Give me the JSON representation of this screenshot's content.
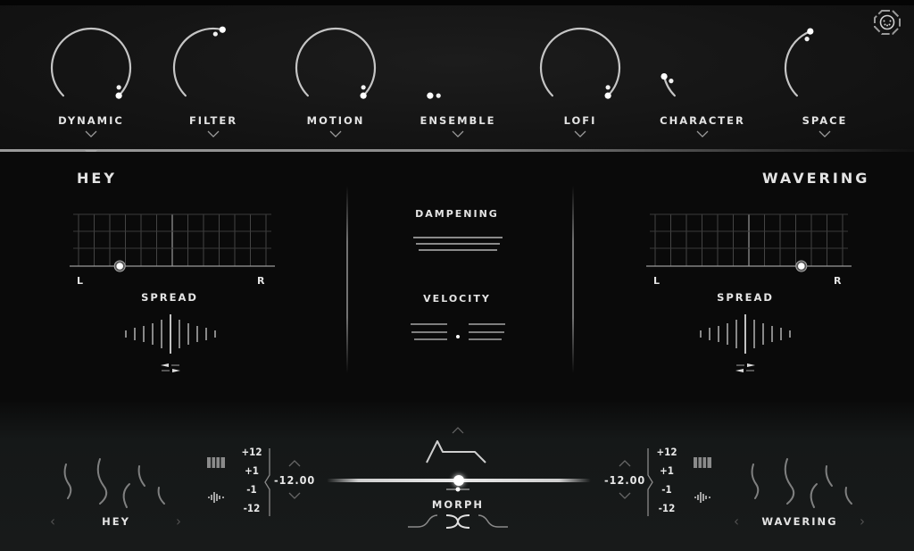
{
  "knobs": [
    {
      "id": "dynamic",
      "label": "DYNAMIC",
      "value": 1.0
    },
    {
      "id": "filter",
      "label": "FILTER",
      "value": 0.55
    },
    {
      "id": "motion",
      "label": "MOTION",
      "value": 1.0
    },
    {
      "id": "ensemble",
      "label": "ENSEMBLE",
      "value": 0.0
    },
    {
      "id": "lofi",
      "label": "LOFI",
      "value": 1.0
    },
    {
      "id": "character",
      "label": "CHARACTER",
      "value": 0.12
    },
    {
      "id": "space",
      "label": "SPACE",
      "value": 0.42
    }
  ],
  "icons": {
    "midi": "midi-connector-icon",
    "chevron": "chevron-down-icon"
  },
  "left": {
    "title": "HEY",
    "pan_label_left": "L",
    "pan_label_right": "R",
    "pan_value": 0.22,
    "spread_label": "SPREAD",
    "preset_name": "HEY",
    "pitch_options": [
      "+12",
      "+1",
      "-1",
      "-12"
    ],
    "pitch_value": "-12.00"
  },
  "right": {
    "title": "WAVERING",
    "pan_label_left": "L",
    "pan_label_right": "R",
    "pan_value": 0.78,
    "spread_label": "SPREAD",
    "preset_name": "WAVERING",
    "pitch_options": [
      "+12",
      "+1",
      "-1",
      "-12"
    ],
    "pitch_value": "-12.00"
  },
  "center": {
    "dampening_label": "DAMPENING",
    "velocity_label": "VELOCITY"
  },
  "morph": {
    "label": "MORPH",
    "value": 0.5
  },
  "colors": {
    "accent": "#ffffff",
    "text": "#e4e4e4",
    "panel_top": "#151515",
    "panel_mid": "#0a0a0a",
    "panel_bottom": "#181a1a"
  }
}
